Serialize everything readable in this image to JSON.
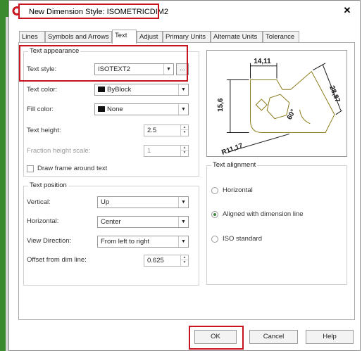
{
  "window": {
    "title": "New Dimension Style: ISOMETRICDIM2",
    "close_glyph": "✕",
    "icon": "autocad-app-icon"
  },
  "tabs": [
    {
      "label": "Lines",
      "active": false
    },
    {
      "label": "Symbols and Arrows",
      "active": false
    },
    {
      "label": "Text",
      "active": true
    },
    {
      "label": "Adjust",
      "active": false
    },
    {
      "label": "Primary Units",
      "active": false
    },
    {
      "label": "Alternate Units",
      "active": false
    },
    {
      "label": "Tolerance",
      "active": false
    }
  ],
  "text_appearance": {
    "group_label": "Text appearance",
    "text_style": {
      "label": "Text style:",
      "value": "ISOTEXT2",
      "browse_label": "..."
    },
    "text_color": {
      "label": "Text color:",
      "value": "ByBlock",
      "swatch": "#111111"
    },
    "fill_color": {
      "label": "Fill color:",
      "value": "None",
      "swatch": "#111111"
    },
    "text_height": {
      "label": "Text height:",
      "value": "2.5"
    },
    "fraction_height_scale": {
      "label": "Fraction height scale:",
      "value": "1",
      "enabled": false
    },
    "draw_frame": {
      "label": "Draw frame around text",
      "checked": false
    }
  },
  "text_placement": {
    "group_label": "Text position",
    "vertical": {
      "label": "Vertical:",
      "value": "Up"
    },
    "horizontal": {
      "label": "Horizontal:",
      "value": "Center"
    },
    "view_direction": {
      "label": "View Direction:",
      "value": "From left to right"
    },
    "offset": {
      "label": "Offset from dim line:",
      "value": "0.625"
    }
  },
  "text_alignment": {
    "group_label": "Text alignment",
    "options": [
      {
        "label": "Horizontal",
        "selected": false
      },
      {
        "label": "Aligned with dimension line",
        "selected": true
      },
      {
        "label": "ISO standard",
        "selected": false
      }
    ]
  },
  "preview": {
    "dims": {
      "top": "14,11",
      "left": "15,6",
      "right": "28,87",
      "angle": "60°",
      "radius": "R11,17"
    },
    "line_color": "#8a7a1a",
    "text_color": "#111111"
  },
  "buttons": {
    "ok": "OK",
    "cancel": "Cancel",
    "help": "Help"
  },
  "highlight_color": "#c8141e"
}
